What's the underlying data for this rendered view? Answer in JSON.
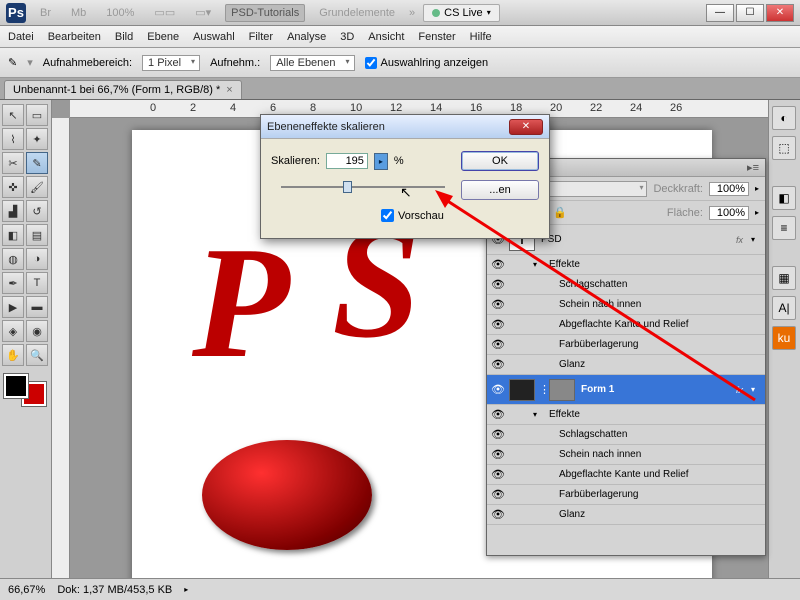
{
  "topbar": {
    "app_icon": "Ps",
    "buttons": [
      "Br",
      "Mb"
    ],
    "zoom_preset": "100%",
    "view_mode": "▭▭",
    "doc_label": "PSD-Tutorials",
    "workspace": "Grundelemente",
    "more": "»",
    "cslive": "CS Live",
    "win": {
      "min": "—",
      "max": "☐",
      "close": "✕"
    }
  },
  "menu": [
    "Datei",
    "Bearbeiten",
    "Bild",
    "Ebene",
    "Auswahl",
    "Filter",
    "Analyse",
    "3D",
    "Ansicht",
    "Fenster",
    "Hilfe"
  ],
  "optbar": {
    "tool_icon": "✎",
    "label1": "Aufnahmebereich:",
    "combo1": "1 Pixel",
    "label2": "Aufnehm.:",
    "combo2": "Alle Ebenen",
    "cb_label": "Auswahlring anzeigen"
  },
  "tab": {
    "title": "Unbenannt-1 bei 66,7% (Form 1, RGB/8) *",
    "close": "×"
  },
  "ruler_marks": [
    "0",
    "2",
    "4",
    "6",
    "8",
    "10",
    "12",
    "14",
    "16",
    "18",
    "20",
    "22",
    "24",
    "26"
  ],
  "panel": {
    "menu_icon": "▸≡",
    "opacity_lbl": "Deckkraft:",
    "opacity_val": "100%",
    "fill_lbl": "Fläche:",
    "fill_val": "100%",
    "lock_icons": [
      "⬚",
      "✎",
      "✥",
      "🔒"
    ],
    "layers": [
      {
        "type": "text",
        "name": "PSD",
        "fx": "fx"
      },
      {
        "type": "group",
        "name": "Effekte"
      },
      {
        "type": "fx",
        "name": "Schlagschatten"
      },
      {
        "type": "fx",
        "name": "Schein nach innen"
      },
      {
        "type": "fx",
        "name": "Abgeflachte Kante und Relief"
      },
      {
        "type": "fx",
        "name": "Farbüberlagerung"
      },
      {
        "type": "fx",
        "name": "Glanz"
      },
      {
        "type": "shape",
        "name": "Form 1",
        "fx": "fx",
        "selected": true
      },
      {
        "type": "group",
        "name": "Effekte"
      },
      {
        "type": "fx",
        "name": "Schlagschatten"
      },
      {
        "type": "fx",
        "name": "Schein nach innen"
      },
      {
        "type": "fx",
        "name": "Abgeflachte Kante und Relief"
      },
      {
        "type": "fx",
        "name": "Farbüberlagerung"
      },
      {
        "type": "fx",
        "name": "Glanz"
      }
    ]
  },
  "dialog": {
    "title": "Ebeneneffekte skalieren",
    "field_lbl": "Skalieren:",
    "value": "195",
    "unit": "%",
    "ok": "OK",
    "cancel": "...en",
    "preview": "Vorschau"
  },
  "status": {
    "zoom": "66,67%",
    "doc": "Dok: 1,37 MB/453,5 KB"
  },
  "art": {
    "p": "P",
    "s": "S"
  },
  "dock_icons": [
    "◐",
    "⬚",
    "◧",
    "≡",
    "▦",
    "A|",
    "ku"
  ]
}
